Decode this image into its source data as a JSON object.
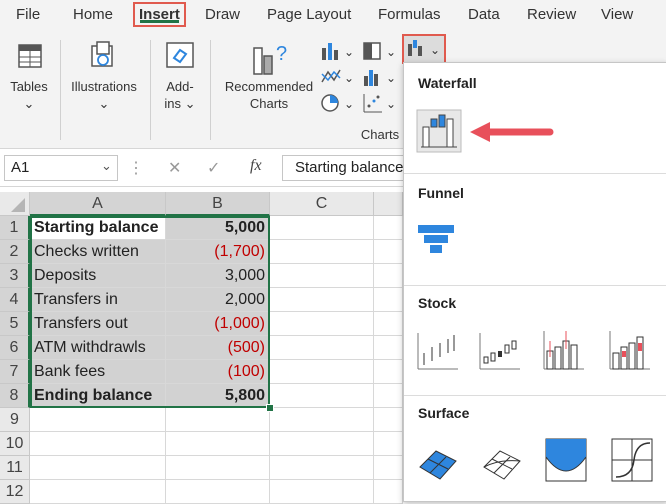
{
  "menu": {
    "items": [
      "File",
      "Home",
      "Insert",
      "Draw",
      "Page Layout",
      "Formulas",
      "Data",
      "Review",
      "View"
    ],
    "active": "Insert"
  },
  "ribbon": {
    "tables_label": "Tables",
    "illustrations_label": "Illustrations",
    "addins_line1": "Add-",
    "addins_line2": "ins",
    "recommended_line1": "Recommended",
    "recommended_line2": "Charts",
    "charts_group_label": "Charts"
  },
  "formula_bar": {
    "name_box": "A1",
    "cancel": "✕",
    "enter": "✓",
    "fx": "fx",
    "content": "Starting balance"
  },
  "sheet": {
    "columns": [
      "A",
      "B",
      "C"
    ],
    "rows": [
      {
        "num": "1",
        "a": "Starting balance",
        "b": "5,000"
      },
      {
        "num": "2",
        "a": "Checks written",
        "b": "(1,700)"
      },
      {
        "num": "3",
        "a": "Deposits",
        "b": "3,000"
      },
      {
        "num": "4",
        "a": "Transfers in",
        "b": "2,000"
      },
      {
        "num": "5",
        "a": "Transfers out",
        "b": "(1,000)"
      },
      {
        "num": "6",
        "a": "ATM withdrawls",
        "b": "(500)"
      },
      {
        "num": "7",
        "a": "Bank fees",
        "b": "(100)"
      },
      {
        "num": "8",
        "a": "Ending balance",
        "b": "5,800"
      },
      {
        "num": "9",
        "a": "",
        "b": ""
      },
      {
        "num": "10",
        "a": "",
        "b": ""
      },
      {
        "num": "11",
        "a": "",
        "b": ""
      },
      {
        "num": "12",
        "a": "",
        "b": ""
      }
    ]
  },
  "dropdown": {
    "sections": {
      "waterfall": "Waterfall",
      "funnel": "Funnel",
      "stock": "Stock",
      "surface": "Surface"
    }
  },
  "colors": {
    "accent_green": "#217346",
    "highlight_red": "#e05a4e",
    "negative_red": "#c00000",
    "chart_blue": "#2e86de"
  }
}
